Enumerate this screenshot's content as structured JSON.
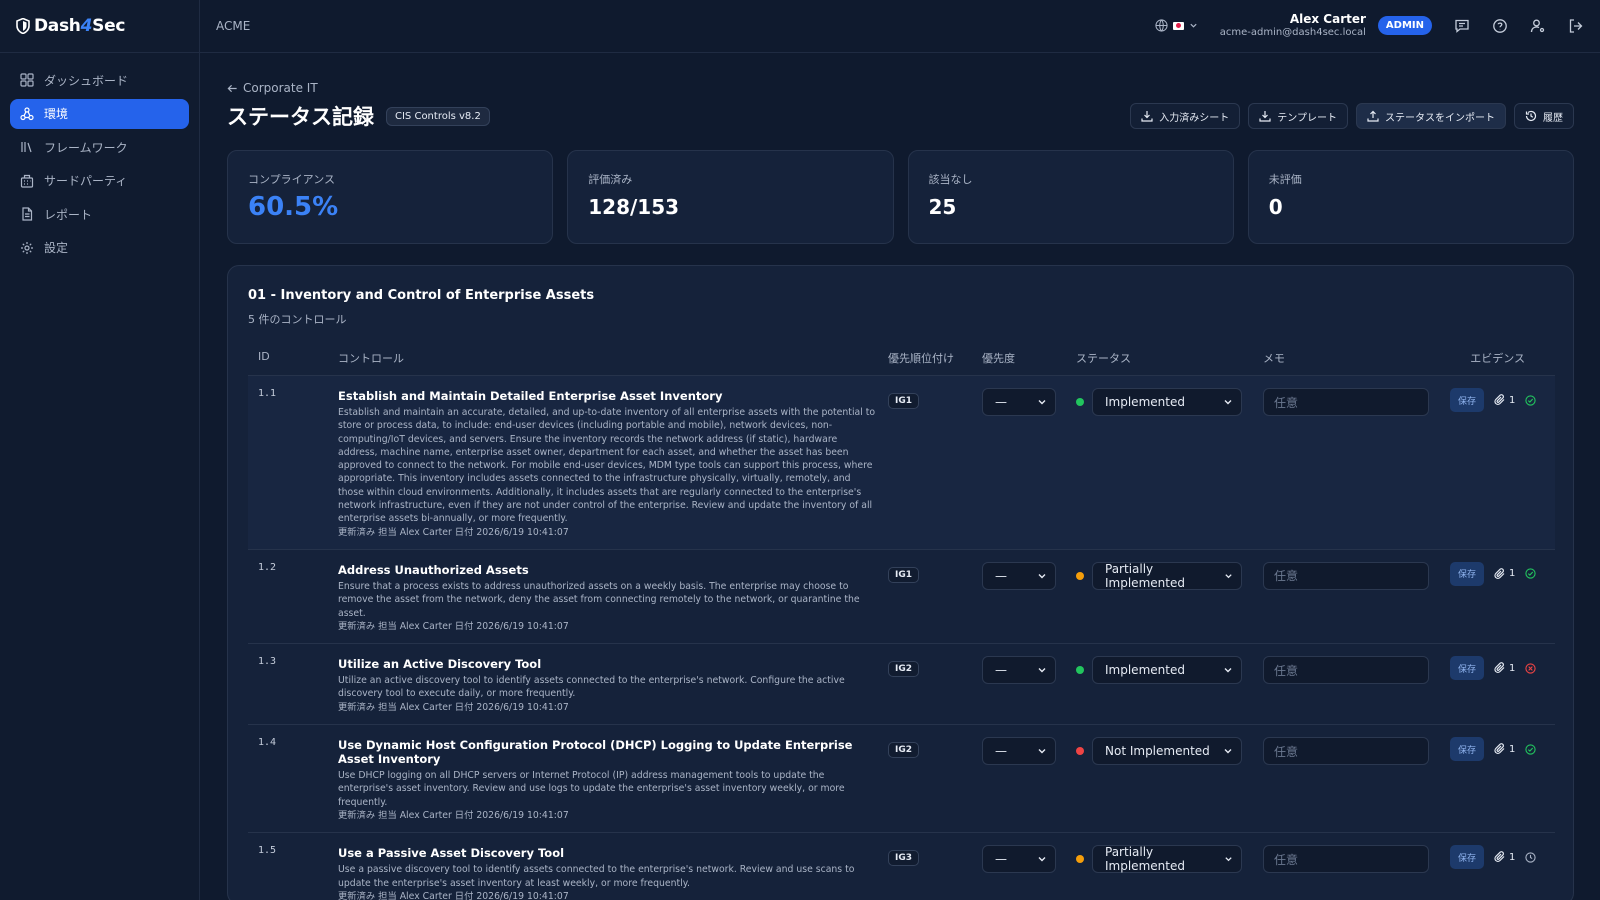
{
  "brand": {
    "name_part1": "Dash",
    "name_part2": "4",
    "name_part3": "Sec"
  },
  "sidebar": {
    "items": [
      {
        "label": "ダッシュボード",
        "icon": "grid-icon",
        "active": false
      },
      {
        "label": "環境",
        "icon": "network-icon",
        "active": true
      },
      {
        "label": "フレームワーク",
        "icon": "library-icon",
        "active": false
      },
      {
        "label": "サードパーティ",
        "icon": "building-icon",
        "active": false
      },
      {
        "label": "レポート",
        "icon": "document-icon",
        "active": false
      },
      {
        "label": "設定",
        "icon": "gear-icon",
        "active": false
      }
    ]
  },
  "header": {
    "org": "ACME",
    "user_name": "Alex Carter",
    "user_email": "acme-admin@dash4sec.local",
    "role_badge": "ADMIN"
  },
  "page": {
    "back_label": "Corporate IT",
    "title": "ステータス記録",
    "framework_badge": "CIS Controls v8.2",
    "actions": {
      "filled_sheet": "入力済みシート",
      "template": "テンプレート",
      "import_status": "ステータスをインポート",
      "history": "履歴"
    }
  },
  "stats": {
    "compliance_label": "コンプライアンス",
    "compliance_value": "60.5%",
    "assessed_label": "評価済み",
    "assessed_value": "128/153",
    "na_label": "該当なし",
    "na_value": "25",
    "unassessed_label": "未評価",
    "unassessed_value": "0"
  },
  "section": {
    "title": "01 - Inventory and Control of Enterprise Assets",
    "subtitle": "5 件のコントロール",
    "columns": {
      "id": "ID",
      "control": "コントロール",
      "prioritization": "優先順位付け",
      "priority": "優先度",
      "status": "ステータス",
      "memo": "メモ",
      "evidence": "エビデンス"
    },
    "memo_placeholder": "任意",
    "save_label": "保存",
    "priority_value": "—",
    "rows": [
      {
        "id": "1.1",
        "title": "Establish and Maintain Detailed Enterprise Asset Inventory",
        "desc": "Establish and maintain an accurate, detailed, and up-to-date inventory of all enterprise assets with the potential to store or process data, to include: end-user devices (including portable and mobile), network devices, non-computing/IoT devices, and servers. Ensure the inventory records the network address (if static), hardware address, machine name, enterprise asset owner, department for each asset, and whether the asset has been approved to connect to the network. For mobile end-user devices, MDM type tools can support this process, where appropriate. This inventory includes assets connected to the infrastructure physically, virtually, remotely, and those within cloud environments. Additionally, it includes assets that are regularly connected to the enterprise's network infrastructure, even if they are not under control of the enterprise. Review and update the inventory of all enterprise assets bi-annually, or more frequently.",
        "meta": "更新済み 担当 Alex Carter 日付 2026/6/19 10:41:07",
        "ig": "IG1",
        "status": "Implemented",
        "status_color": "#22c55e",
        "evidence_count": "1",
        "evidence_state": "ok"
      },
      {
        "id": "1.2",
        "title": "Address Unauthorized Assets",
        "desc": "Ensure that a process exists to address unauthorized assets on a weekly basis. The enterprise may choose to remove the asset from the network, deny the asset from connecting remotely to the network, or quarantine the asset.",
        "meta": "更新済み 担当 Alex Carter 日付 2026/6/19 10:41:07",
        "ig": "IG1",
        "status": "Partially Implemented",
        "status_color": "#f59e0b",
        "evidence_count": "1",
        "evidence_state": "ok"
      },
      {
        "id": "1.3",
        "title": "Utilize an Active Discovery Tool",
        "desc": "Utilize an active discovery tool to identify assets connected to the enterprise's network. Configure the active discovery tool to execute daily, or more frequently.",
        "meta": "更新済み 担当 Alex Carter 日付 2026/6/19 10:41:07",
        "ig": "IG2",
        "status": "Implemented",
        "status_color": "#22c55e",
        "evidence_count": "1",
        "evidence_state": "error"
      },
      {
        "id": "1.4",
        "title": "Use Dynamic Host Configuration Protocol (DHCP) Logging to Update Enterprise Asset Inventory",
        "desc": "Use DHCP logging on all DHCP servers or Internet Protocol (IP) address management tools to update the enterprise's asset inventory. Review and use logs to update the enterprise's asset inventory weekly, or more frequently.",
        "meta": "更新済み 担当 Alex Carter 日付 2026/6/19 10:41:07",
        "ig": "IG2",
        "status": "Not Implemented",
        "status_color": "#ef4444",
        "evidence_count": "1",
        "evidence_state": "ok"
      },
      {
        "id": "1.5",
        "title": "Use a Passive Asset Discovery Tool",
        "desc": "Use a passive discovery tool to identify assets connected to the enterprise's network. Review and use scans to update the enterprise's asset inventory at least weekly, or more frequently.",
        "meta": "更新済み 担当 Alex Carter 日付 2026/6/19 10:41:07",
        "ig": "IG3",
        "status": "Partially Implemented",
        "status_color": "#f59e0b",
        "evidence_count": "1",
        "evidence_state": "pending"
      }
    ]
  }
}
